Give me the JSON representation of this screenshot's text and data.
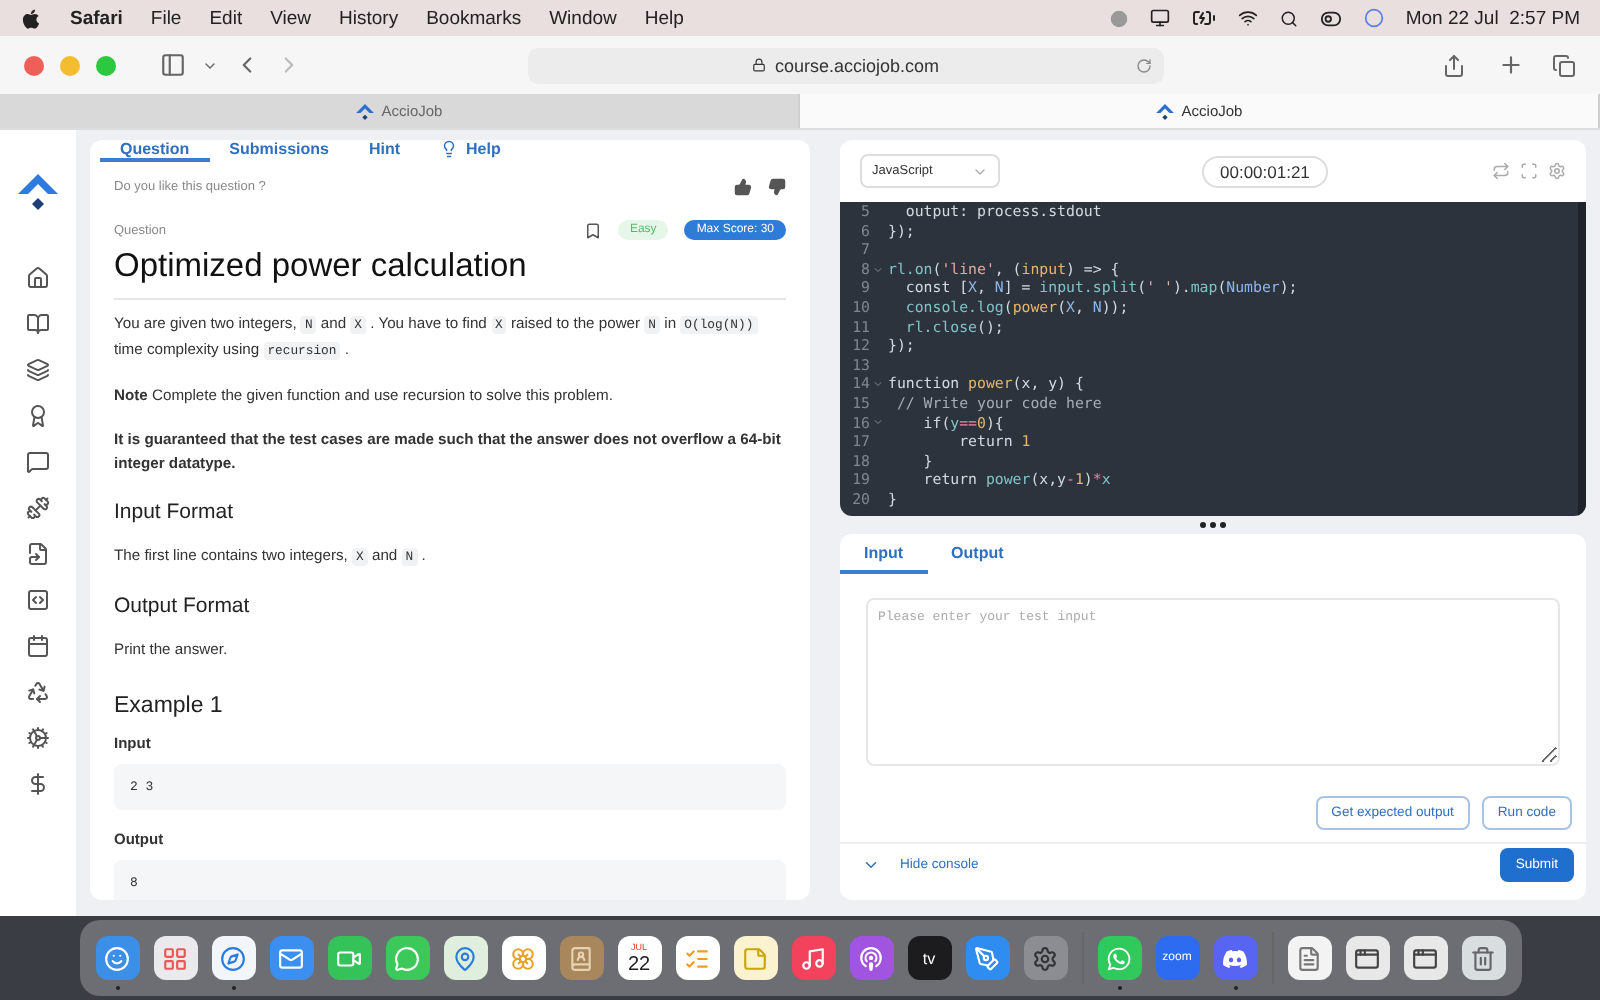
{
  "menubar": {
    "app": "Safari",
    "menus": [
      "File",
      "Edit",
      "View",
      "History",
      "Bookmarks",
      "Window",
      "Help"
    ],
    "clock": "Mon 22 Jul  2:57 PM"
  },
  "browser": {
    "url": "course.acciojob.com",
    "tabs": [
      {
        "title": "AccioJob",
        "selected": false
      },
      {
        "title": "AccioJob",
        "selected": true
      }
    ]
  },
  "question_panel": {
    "tabs": [
      {
        "label": "Question",
        "selected": true,
        "kind": "plain"
      },
      {
        "label": "Submissions",
        "selected": false,
        "kind": "plain"
      },
      {
        "label": "Hint",
        "selected": false,
        "kind": "plain"
      },
      {
        "label": "Help",
        "selected": false,
        "kind": "help"
      }
    ],
    "feedback_prompt": "Do you like this question ?",
    "section_label": "Question",
    "difficulty": "Easy",
    "max_score": "Max Score: 30",
    "title": "Optimized power calculation",
    "blocks": [
      {
        "kind": "paragraph",
        "segments": [
          {
            "kind": "text",
            "text": "You are given two integers, "
          },
          {
            "kind": "code",
            "text": "N"
          },
          {
            "kind": "text",
            "text": " and "
          },
          {
            "kind": "code",
            "text": "X"
          },
          {
            "kind": "text",
            "text": " . You have to find "
          },
          {
            "kind": "code",
            "text": "X"
          },
          {
            "kind": "text",
            "text": " raised to the power "
          },
          {
            "kind": "code",
            "text": "N"
          },
          {
            "kind": "text",
            "text": " in "
          },
          {
            "kind": "code",
            "text": "O(log(N))"
          },
          {
            "kind": "text",
            "text": " time complexity using "
          },
          {
            "kind": "code",
            "text": "recursion"
          },
          {
            "kind": "text",
            "text": " ."
          }
        ]
      },
      {
        "kind": "paragraph",
        "segments": [
          {
            "kind": "strong",
            "text": "Note"
          },
          {
            "kind": "text",
            "text": " Complete the given function and use recursion to solve this problem."
          }
        ]
      },
      {
        "kind": "paragraph",
        "segments": [
          {
            "kind": "strong",
            "text": "It is guaranteed that the test cases are made such that the answer does not overflow a 64-bit integer datatype."
          }
        ]
      },
      {
        "kind": "heading",
        "text": "Input Format"
      },
      {
        "kind": "paragraph",
        "segments": [
          {
            "kind": "text",
            "text": "The first line contains two integers, "
          },
          {
            "kind": "code",
            "text": "X"
          },
          {
            "kind": "text",
            "text": " and "
          },
          {
            "kind": "code",
            "text": "N"
          },
          {
            "kind": "text",
            "text": " ."
          }
        ]
      },
      {
        "kind": "heading",
        "text": "Output Format"
      },
      {
        "kind": "paragraph",
        "segments": [
          {
            "kind": "text",
            "text": "Print the answer."
          }
        ]
      },
      {
        "kind": "heading",
        "text": "Example 1"
      },
      {
        "kind": "label",
        "text": "Input"
      },
      {
        "kind": "sample",
        "text": "2 3"
      },
      {
        "kind": "label",
        "text": "Output"
      },
      {
        "kind": "sample",
        "text": "8"
      }
    ]
  },
  "editor": {
    "language": "JavaScript",
    "timer": "00:00:01:21",
    "lines": [
      {
        "number": "5",
        "foldable": false,
        "tokens": [
          {
            "kind": "plain",
            "text": "  output: process.stdout"
          }
        ]
      },
      {
        "number": "6",
        "foldable": false,
        "tokens": [
          {
            "kind": "plain",
            "text": "});"
          }
        ]
      },
      {
        "number": "7",
        "foldable": false
      },
      {
        "number": "8",
        "foldable": true,
        "tokens": [
          {
            "kind": "fn",
            "text": "rl.on"
          },
          {
            "kind": "plain",
            "text": "("
          },
          {
            "kind": "str",
            "text": "'line'"
          },
          {
            "kind": "plain",
            "text": ", ("
          },
          {
            "kind": "param",
            "text": "input"
          },
          {
            "kind": "plain",
            "text": ") => {"
          }
        ]
      },
      {
        "number": "9",
        "foldable": false,
        "tokens": [
          {
            "kind": "plain",
            "text": "  const ["
          },
          {
            "kind": "var",
            "text": "X"
          },
          {
            "kind": "plain",
            "text": ", "
          },
          {
            "kind": "var",
            "text": "N"
          },
          {
            "kind": "plain",
            "text": "] = "
          },
          {
            "kind": "fn",
            "text": "input.split"
          },
          {
            "kind": "plain",
            "text": "("
          },
          {
            "kind": "str",
            "text": "' '"
          },
          {
            "kind": "plain",
            "text": ")."
          },
          {
            "kind": "fn",
            "text": "map"
          },
          {
            "kind": "plain",
            "text": "("
          },
          {
            "kind": "var",
            "text": "Number"
          },
          {
            "kind": "plain",
            "text": ");"
          }
        ]
      },
      {
        "number": "10",
        "foldable": false,
        "tokens": [
          {
            "kind": "fn",
            "text": "  console.log"
          },
          {
            "kind": "plain",
            "text": "("
          },
          {
            "kind": "param",
            "text": "power"
          },
          {
            "kind": "plain",
            "text": "("
          },
          {
            "kind": "var",
            "text": "X"
          },
          {
            "kind": "plain",
            "text": ", "
          },
          {
            "kind": "var",
            "text": "N"
          },
          {
            "kind": "plain",
            "text": "));"
          }
        ]
      },
      {
        "number": "11",
        "foldable": false,
        "tokens": [
          {
            "kind": "fn",
            "text": "  rl.close"
          },
          {
            "kind": "plain",
            "text": "();"
          }
        ]
      },
      {
        "number": "12",
        "foldable": false,
        "tokens": [
          {
            "kind": "plain",
            "text": "});"
          }
        ]
      },
      {
        "number": "13",
        "foldable": false
      },
      {
        "number": "14",
        "foldable": true,
        "tokens": [
          {
            "kind": "plain",
            "text": "function "
          },
          {
            "kind": "param",
            "text": "power"
          },
          {
            "kind": "plain",
            "text": "(x, y) {"
          }
        ]
      },
      {
        "number": "15",
        "foldable": false,
        "tokens": [
          {
            "kind": "comment",
            "text": " // Write your code here"
          }
        ]
      },
      {
        "number": "16",
        "foldable": true,
        "tokens": [
          {
            "kind": "plain",
            "text": "    if("
          },
          {
            "kind": "fn",
            "text": "y"
          },
          {
            "kind": "op",
            "text": "=="
          },
          {
            "kind": "num",
            "text": "0"
          },
          {
            "kind": "plain",
            "text": "){"
          }
        ]
      },
      {
        "number": "17",
        "foldable": false,
        "tokens": [
          {
            "kind": "plain",
            "text": "        return "
          },
          {
            "kind": "num",
            "text": "1"
          }
        ]
      },
      {
        "number": "18",
        "foldable": false,
        "tokens": [
          {
            "kind": "plain",
            "text": "    }"
          }
        ]
      },
      {
        "number": "19",
        "foldable": false,
        "tokens": [
          {
            "kind": "plain",
            "text": "    return "
          },
          {
            "kind": "fn",
            "text": "power"
          },
          {
            "kind": "plain",
            "text": "(x,y"
          },
          {
            "kind": "op",
            "text": "-"
          },
          {
            "kind": "num",
            "text": "1"
          },
          {
            "kind": "plain",
            "text": ")"
          },
          {
            "kind": "op",
            "text": "*"
          },
          {
            "kind": "fn",
            "text": "x"
          }
        ]
      },
      {
        "number": "20",
        "foldable": false,
        "tokens": [
          {
            "kind": "plain",
            "text": "}"
          }
        ]
      }
    ]
  },
  "console": {
    "tabs": [
      {
        "label": "Input",
        "selected": true
      },
      {
        "label": "Output",
        "selected": false
      }
    ],
    "placeholder": "Please enter your test input",
    "buttons": [
      "Get expected output",
      "Run code"
    ],
    "toggle": "Hide console",
    "submit": "Submit"
  },
  "dock": [
    {
      "kind": "finder",
      "running": true
    },
    {
      "kind": "launchpad",
      "running": false
    },
    {
      "kind": "safari",
      "running": true
    },
    {
      "kind": "mail",
      "running": false
    },
    {
      "kind": "facetime",
      "running": false
    },
    {
      "kind": "messages",
      "running": false
    },
    {
      "kind": "maps",
      "running": false
    },
    {
      "kind": "photos",
      "running": false
    },
    {
      "kind": "contacts",
      "running": false
    },
    {
      "kind": "calendar",
      "running": false,
      "month": "JUL",
      "day": "22"
    },
    {
      "kind": "reminders",
      "running": false
    },
    {
      "kind": "notes",
      "running": false
    },
    {
      "kind": "music",
      "running": false
    },
    {
      "kind": "podcasts",
      "running": false
    },
    {
      "kind": "tv",
      "running": false,
      "label": "tv"
    },
    {
      "kind": "appstore",
      "running": false
    },
    {
      "kind": "settings",
      "running": false
    },
    {
      "kind": "separator"
    },
    {
      "kind": "whatsapp",
      "running": true
    },
    {
      "kind": "zoom",
      "running": false,
      "label": "zoom"
    },
    {
      "kind": "discord",
      "running": true
    },
    {
      "kind": "separator"
    },
    {
      "kind": "document",
      "running": false
    },
    {
      "kind": "window",
      "running": false
    },
    {
      "kind": "window",
      "running": false
    },
    {
      "kind": "trash",
      "running": false
    }
  ]
}
